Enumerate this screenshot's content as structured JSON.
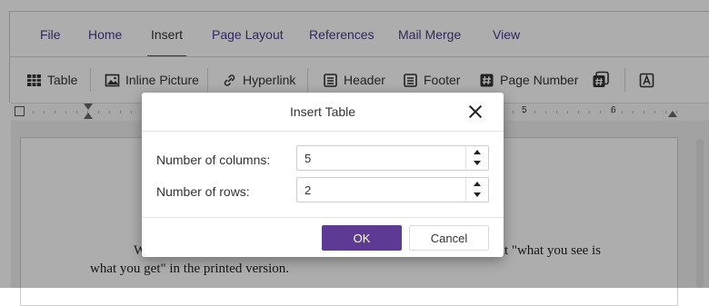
{
  "tabs": [
    "File",
    "Home",
    "Insert",
    "Page Layout",
    "References",
    "Mail Merge",
    "View"
  ],
  "active_tab": "Insert",
  "toolbar": {
    "table": "Table",
    "inline_picture": "Inline Picture",
    "hyperlink": "Hyperlink",
    "header": "Header",
    "footer": "Footer",
    "page_number": "Page Number"
  },
  "ruler": {
    "marks": [
      "5",
      "6"
    ]
  },
  "document": {
    "line1": "W",
    "line1_right": "uch that \"what you see is",
    "line2": "what you get\" in the printed version."
  },
  "dialog": {
    "title": "Insert Table",
    "columns_label": "Number of columns:",
    "columns_value": "5",
    "rows_label": "Number of rows:",
    "rows_value": "2",
    "ok_label": "OK",
    "cancel_label": "Cancel"
  },
  "colors": {
    "accent": "#5d3a93",
    "tab_text": "#4b3a8c"
  }
}
